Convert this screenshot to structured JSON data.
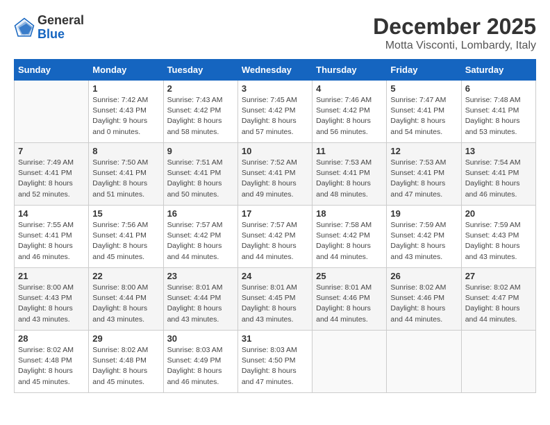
{
  "header": {
    "logo_general": "General",
    "logo_blue": "Blue",
    "month": "December 2025",
    "location": "Motta Visconti, Lombardy, Italy"
  },
  "weekdays": [
    "Sunday",
    "Monday",
    "Tuesday",
    "Wednesday",
    "Thursday",
    "Friday",
    "Saturday"
  ],
  "weeks": [
    [
      {
        "day": "",
        "content": ""
      },
      {
        "day": "1",
        "content": "Sunrise: 7:42 AM\nSunset: 4:43 PM\nDaylight: 9 hours\nand 0 minutes."
      },
      {
        "day": "2",
        "content": "Sunrise: 7:43 AM\nSunset: 4:42 PM\nDaylight: 8 hours\nand 58 minutes."
      },
      {
        "day": "3",
        "content": "Sunrise: 7:45 AM\nSunset: 4:42 PM\nDaylight: 8 hours\nand 57 minutes."
      },
      {
        "day": "4",
        "content": "Sunrise: 7:46 AM\nSunset: 4:42 PM\nDaylight: 8 hours\nand 56 minutes."
      },
      {
        "day": "5",
        "content": "Sunrise: 7:47 AM\nSunset: 4:41 PM\nDaylight: 8 hours\nand 54 minutes."
      },
      {
        "day": "6",
        "content": "Sunrise: 7:48 AM\nSunset: 4:41 PM\nDaylight: 8 hours\nand 53 minutes."
      }
    ],
    [
      {
        "day": "7",
        "content": "Sunrise: 7:49 AM\nSunset: 4:41 PM\nDaylight: 8 hours\nand 52 minutes."
      },
      {
        "day": "8",
        "content": "Sunrise: 7:50 AM\nSunset: 4:41 PM\nDaylight: 8 hours\nand 51 minutes."
      },
      {
        "day": "9",
        "content": "Sunrise: 7:51 AM\nSunset: 4:41 PM\nDaylight: 8 hours\nand 50 minutes."
      },
      {
        "day": "10",
        "content": "Sunrise: 7:52 AM\nSunset: 4:41 PM\nDaylight: 8 hours\nand 49 minutes."
      },
      {
        "day": "11",
        "content": "Sunrise: 7:53 AM\nSunset: 4:41 PM\nDaylight: 8 hours\nand 48 minutes."
      },
      {
        "day": "12",
        "content": "Sunrise: 7:53 AM\nSunset: 4:41 PM\nDaylight: 8 hours\nand 47 minutes."
      },
      {
        "day": "13",
        "content": "Sunrise: 7:54 AM\nSunset: 4:41 PM\nDaylight: 8 hours\nand 46 minutes."
      }
    ],
    [
      {
        "day": "14",
        "content": "Sunrise: 7:55 AM\nSunset: 4:41 PM\nDaylight: 8 hours\nand 46 minutes."
      },
      {
        "day": "15",
        "content": "Sunrise: 7:56 AM\nSunset: 4:41 PM\nDaylight: 8 hours\nand 45 minutes."
      },
      {
        "day": "16",
        "content": "Sunrise: 7:57 AM\nSunset: 4:42 PM\nDaylight: 8 hours\nand 44 minutes."
      },
      {
        "day": "17",
        "content": "Sunrise: 7:57 AM\nSunset: 4:42 PM\nDaylight: 8 hours\nand 44 minutes."
      },
      {
        "day": "18",
        "content": "Sunrise: 7:58 AM\nSunset: 4:42 PM\nDaylight: 8 hours\nand 44 minutes."
      },
      {
        "day": "19",
        "content": "Sunrise: 7:59 AM\nSunset: 4:42 PM\nDaylight: 8 hours\nand 43 minutes."
      },
      {
        "day": "20",
        "content": "Sunrise: 7:59 AM\nSunset: 4:43 PM\nDaylight: 8 hours\nand 43 minutes."
      }
    ],
    [
      {
        "day": "21",
        "content": "Sunrise: 8:00 AM\nSunset: 4:43 PM\nDaylight: 8 hours\nand 43 minutes."
      },
      {
        "day": "22",
        "content": "Sunrise: 8:00 AM\nSunset: 4:44 PM\nDaylight: 8 hours\nand 43 minutes."
      },
      {
        "day": "23",
        "content": "Sunrise: 8:01 AM\nSunset: 4:44 PM\nDaylight: 8 hours\nand 43 minutes."
      },
      {
        "day": "24",
        "content": "Sunrise: 8:01 AM\nSunset: 4:45 PM\nDaylight: 8 hours\nand 43 minutes."
      },
      {
        "day": "25",
        "content": "Sunrise: 8:01 AM\nSunset: 4:46 PM\nDaylight: 8 hours\nand 44 minutes."
      },
      {
        "day": "26",
        "content": "Sunrise: 8:02 AM\nSunset: 4:46 PM\nDaylight: 8 hours\nand 44 minutes."
      },
      {
        "day": "27",
        "content": "Sunrise: 8:02 AM\nSunset: 4:47 PM\nDaylight: 8 hours\nand 44 minutes."
      }
    ],
    [
      {
        "day": "28",
        "content": "Sunrise: 8:02 AM\nSunset: 4:48 PM\nDaylight: 8 hours\nand 45 minutes."
      },
      {
        "day": "29",
        "content": "Sunrise: 8:02 AM\nSunset: 4:48 PM\nDaylight: 8 hours\nand 45 minutes."
      },
      {
        "day": "30",
        "content": "Sunrise: 8:03 AM\nSunset: 4:49 PM\nDaylight: 8 hours\nand 46 minutes."
      },
      {
        "day": "31",
        "content": "Sunrise: 8:03 AM\nSunset: 4:50 PM\nDaylight: 8 hours\nand 47 minutes."
      },
      {
        "day": "",
        "content": ""
      },
      {
        "day": "",
        "content": ""
      },
      {
        "day": "",
        "content": ""
      }
    ]
  ]
}
